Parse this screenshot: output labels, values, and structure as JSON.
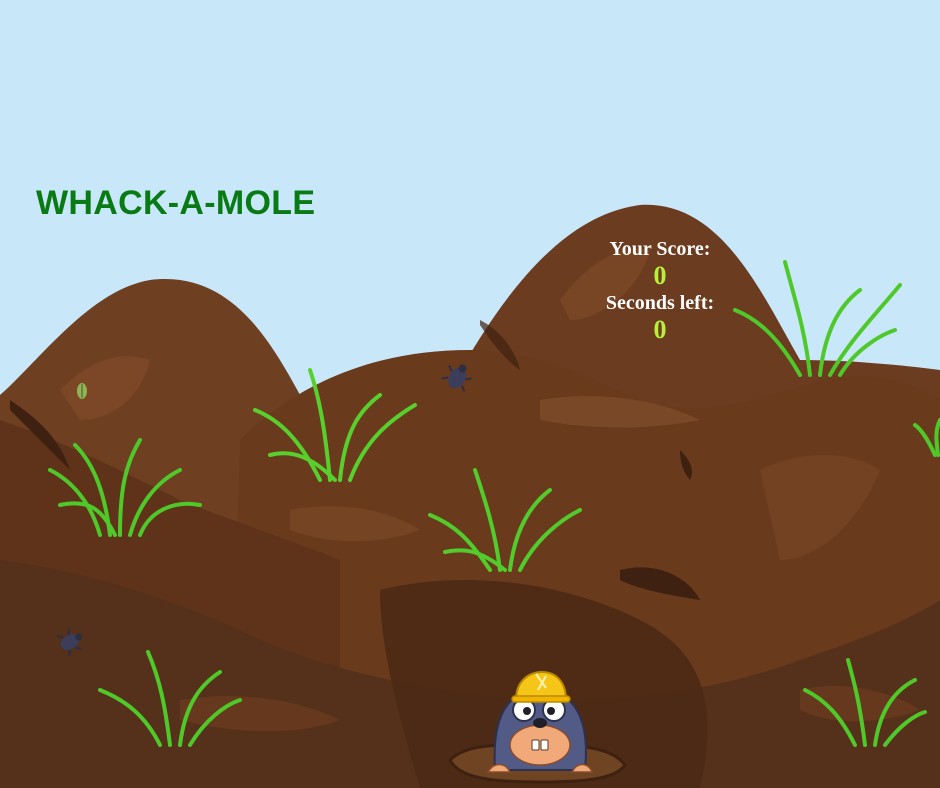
{
  "title": "WHACK-A-MOLE",
  "hud": {
    "score_label": "Your Score:",
    "score_value": "0",
    "seconds_label": "Seconds left:",
    "seconds_value": "0"
  },
  "colors": {
    "sky": "#c8e8fa",
    "title": "#0a7a14",
    "hud_label": "#ffffff",
    "hud_value": "#b8f03a",
    "dirt_dark": "#5a3219",
    "dirt_mid": "#6e3e20",
    "dirt_light": "#8a5530",
    "grass": "#4fc82a"
  },
  "icons": [
    "mole-icon",
    "hard-hat-icon",
    "beetle-icon",
    "grass-tuft-icon",
    "seed-icon"
  ]
}
